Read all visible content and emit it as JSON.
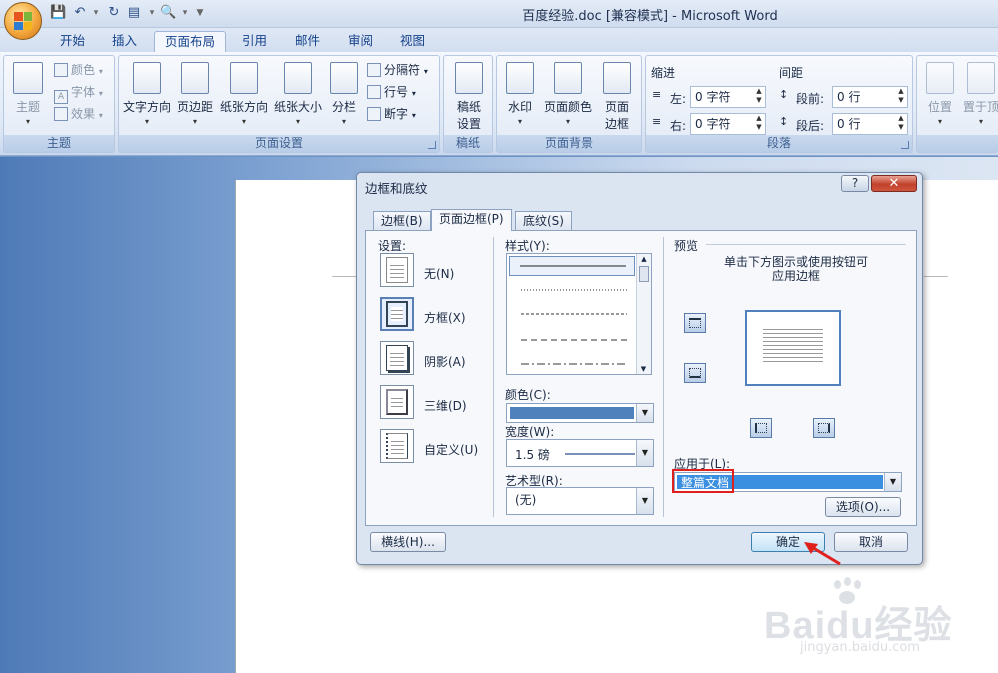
{
  "window": {
    "title": "百度经验.doc [兼容模式] - Microsoft Word"
  },
  "quick_access": {
    "icons": [
      "save-icon",
      "undo-icon",
      "redo-icon",
      "new-icon",
      "print-preview-icon",
      "customize-icon"
    ]
  },
  "ribbon_tabs": [
    "开始",
    "插入",
    "页面布局",
    "引用",
    "邮件",
    "审阅",
    "视图"
  ],
  "active_tab": "页面布局",
  "ribbon": {
    "theme": {
      "label": "主题",
      "big_label": "主题",
      "items": [
        "颜色",
        "字体",
        "效果"
      ]
    },
    "page_setup": {
      "label": "页面设置",
      "buttons": [
        "文字方向",
        "页边距",
        "纸张方向",
        "纸张大小",
        "分栏"
      ],
      "small": [
        "分隔符",
        "行号",
        "断字"
      ]
    },
    "manuscript": {
      "label": "稿纸",
      "button_line1": "稿纸",
      "button_line2": "设置"
    },
    "page_background": {
      "label": "页面背景",
      "buttons": [
        "水印",
        "页面颜色"
      ],
      "border_line1": "页面",
      "border_line2": "边框"
    },
    "paragraph": {
      "label": "段落",
      "indent_title": "缩进",
      "spacing_title": "间距",
      "left_label": "左:",
      "left_value": "0 字符",
      "right_label": "右:",
      "right_value": "0 字符",
      "before_label": "段前:",
      "before_value": "0 行",
      "after_label": "段后:",
      "after_value": "0 行"
    },
    "arrange": {
      "position": "位置",
      "front": "置于顶"
    }
  },
  "dialog": {
    "title": "边框和底纹",
    "help": "?",
    "tabs": [
      "边框(B)",
      "页面边框(P)",
      "底纹(S)"
    ],
    "active_tab": 1,
    "settings_title": "设置:",
    "settings": [
      "无(N)",
      "方框(X)",
      "阴影(A)",
      "三维(D)",
      "自定义(U)"
    ],
    "selected_setting": 1,
    "style_title": "样式(Y):",
    "color_title": "颜色(C):",
    "color_value": "#4f81bd",
    "width_title": "宽度(W):",
    "width_value": "1.5 磅",
    "art_title": "艺术型(R):",
    "art_value": "(无)",
    "preview_title": "预览",
    "preview_hint_line1": "单击下方图示或使用按钮可",
    "preview_hint_line2": "应用边框",
    "apply_to_label": "应用于(L):",
    "apply_to_value": "整篇文档",
    "options_button": "选项(O)...",
    "hline_button": "横线(H)...",
    "ok_button": "确定",
    "cancel_button": "取消"
  },
  "watermark": {
    "brand": "Baidu经验",
    "url": "jingyan.baidu.com"
  }
}
